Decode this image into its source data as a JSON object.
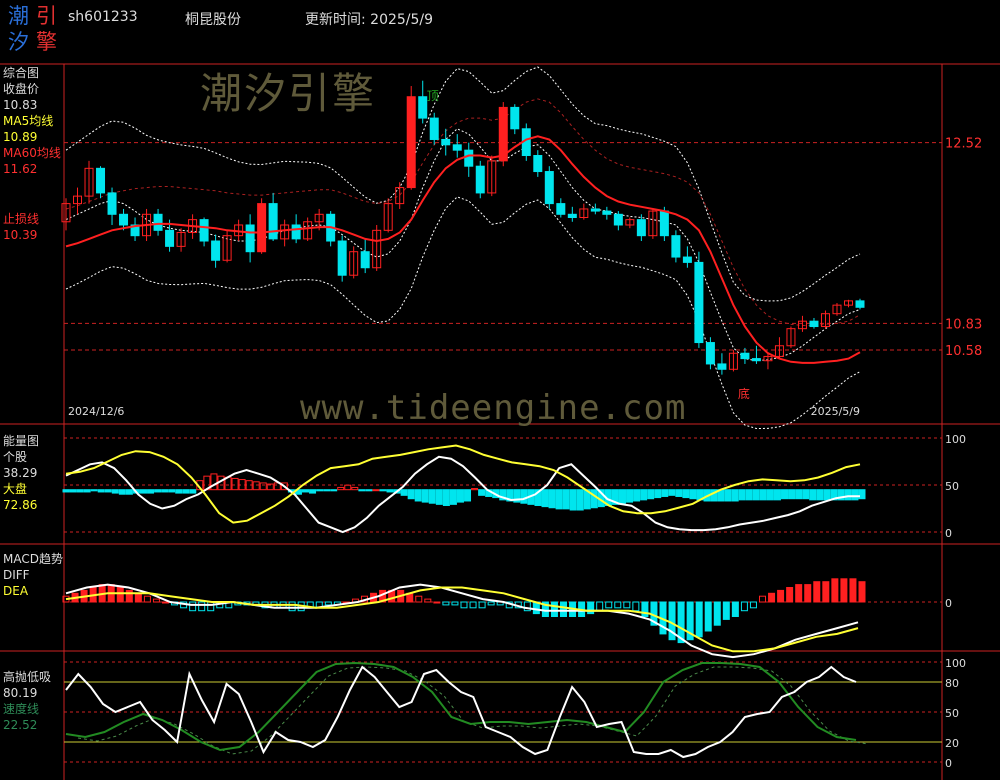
{
  "header": {
    "logo_chars": [
      "潮",
      "引",
      "汐",
      "擎"
    ],
    "code": "sh601233",
    "name": "桐昆股份",
    "update_label": "更新时间: 2025/5/9"
  },
  "watermarks": {
    "cn": "潮汐引擎",
    "url": "www.tideengine.com"
  },
  "colors": {
    "bg": "#000000",
    "frame": "#cc2222",
    "up": "#ff2020",
    "down": "#00e5ee",
    "ma5": "#ffffff",
    "ma60": "#ff2020",
    "band": "#ffffff",
    "energy_stock": "#ffffff",
    "energy_market": "#ffff33",
    "speed": "#228b22",
    "grid": "#cc2222"
  },
  "panels": {
    "main": {
      "title": "综合图",
      "items": [
        {
          "label": "收盘价",
          "value": "10.83",
          "color": "#dddddd"
        },
        {
          "label": "MA5均线",
          "value": "10.89",
          "color": "#ffff33"
        },
        {
          "label": "MA60均线",
          "value": "11.62",
          "color": "#ff3030"
        },
        {
          "label": "止损线",
          "value": "10.39",
          "color": "#ff3030"
        }
      ],
      "axis_labels": [
        "12.52",
        "10.83",
        "10.58"
      ],
      "date_start": "2024/12/6",
      "date_end": "2025/5/9",
      "top_marker": "顶",
      "bottom_marker": "底"
    },
    "energy": {
      "title": "能量图",
      "items": [
        {
          "label": "个股",
          "value": "38.29",
          "color": "#dddddd"
        },
        {
          "label": "大盘",
          "value": "72.86",
          "color": "#ffff33"
        }
      ],
      "axis_labels": [
        "100",
        "50",
        "0"
      ]
    },
    "macd": {
      "title": "MACD趋势",
      "items": [
        {
          "label": "DIFF",
          "value": "",
          "color": "#dddddd"
        },
        {
          "label": "DEA",
          "value": "",
          "color": "#ffff33"
        }
      ],
      "axis_labels": [
        "0"
      ]
    },
    "osc": {
      "title": "高抛低吸",
      "items": [
        {
          "label": "",
          "value": "80.19",
          "color": "#dddddd"
        },
        {
          "label": "速度线",
          "value": "22.52",
          "color": "#2e8b57"
        }
      ],
      "axis_labels": [
        "100",
        "80",
        "50",
        "20",
        "0"
      ]
    }
  },
  "chart_data": [
    {
      "type": "candlestick",
      "title": "综合图",
      "x_range": [
        "2024/12/6",
        "2025/5/9"
      ],
      "ylim": [
        10.15,
        13.2
      ],
      "candles": [
        [
          11.78,
          12.0,
          11.7,
          11.95
        ],
        [
          11.95,
          12.1,
          11.85,
          12.02
        ],
        [
          12.02,
          12.35,
          11.95,
          12.28
        ],
        [
          12.28,
          12.3,
          12.0,
          12.05
        ],
        [
          12.05,
          12.1,
          11.75,
          11.85
        ],
        [
          11.85,
          11.9,
          11.7,
          11.75
        ],
        [
          11.75,
          11.82,
          11.6,
          11.65
        ],
        [
          11.65,
          11.9,
          11.6,
          11.85
        ],
        [
          11.85,
          11.9,
          11.65,
          11.7
        ],
        [
          11.7,
          11.8,
          11.5,
          11.55
        ],
        [
          11.55,
          11.72,
          11.5,
          11.68
        ],
        [
          11.68,
          11.85,
          11.62,
          11.8
        ],
        [
          11.8,
          11.82,
          11.55,
          11.6
        ],
        [
          11.6,
          11.66,
          11.35,
          11.42
        ],
        [
          11.42,
          11.7,
          11.4,
          11.65
        ],
        [
          11.65,
          11.8,
          11.6,
          11.75
        ],
        [
          11.75,
          11.85,
          11.4,
          11.5
        ],
        [
          11.5,
          12.0,
          11.48,
          11.95
        ],
        [
          11.95,
          12.05,
          11.6,
          11.62
        ],
        [
          11.62,
          11.8,
          11.55,
          11.75
        ],
        [
          11.75,
          11.85,
          11.58,
          11.62
        ],
        [
          11.62,
          11.82,
          11.6,
          11.78
        ],
        [
          11.78,
          11.9,
          11.7,
          11.85
        ],
        [
          11.85,
          11.88,
          11.55,
          11.6
        ],
        [
          11.6,
          11.65,
          11.22,
          11.28
        ],
        [
          11.28,
          11.55,
          11.25,
          11.5
        ],
        [
          11.5,
          11.62,
          11.3,
          11.35
        ],
        [
          11.35,
          11.75,
          11.32,
          11.7
        ],
        [
          11.7,
          12.0,
          11.68,
          11.95
        ],
        [
          11.95,
          12.15,
          11.9,
          12.1
        ],
        [
          12.1,
          13.05,
          12.08,
          12.95
        ],
        [
          12.95,
          13.1,
          12.7,
          12.75
        ],
        [
          12.75,
          12.8,
          12.5,
          12.55
        ],
        [
          12.55,
          12.65,
          12.4,
          12.5
        ],
        [
          12.5,
          12.6,
          12.38,
          12.45
        ],
        [
          12.45,
          12.52,
          12.2,
          12.3
        ],
        [
          12.3,
          12.35,
          12.0,
          12.05
        ],
        [
          12.05,
          12.4,
          12.02,
          12.35
        ],
        [
          12.35,
          12.9,
          12.3,
          12.85
        ],
        [
          12.85,
          12.88,
          12.6,
          12.65
        ],
        [
          12.65,
          12.7,
          12.35,
          12.4
        ],
        [
          12.4,
          12.45,
          12.2,
          12.25
        ],
        [
          12.25,
          12.3,
          11.9,
          11.95
        ],
        [
          11.95,
          12.0,
          11.82,
          11.85
        ],
        [
          11.85,
          11.92,
          11.78,
          11.82
        ],
        [
          11.82,
          11.95,
          11.8,
          11.9
        ],
        [
          11.9,
          11.95,
          11.85,
          11.88
        ],
        [
          11.88,
          11.92,
          11.8,
          11.85
        ],
        [
          11.85,
          11.88,
          11.7,
          11.75
        ],
        [
          11.75,
          11.82,
          11.72,
          11.8
        ],
        [
          11.8,
          11.85,
          11.6,
          11.65
        ],
        [
          11.65,
          11.9,
          11.62,
          11.88
        ],
        [
          11.88,
          11.92,
          11.6,
          11.65
        ],
        [
          11.65,
          11.7,
          11.4,
          11.45
        ],
        [
          11.45,
          11.55,
          11.35,
          11.4
        ],
        [
          11.4,
          11.5,
          10.6,
          10.65
        ],
        [
          10.65,
          10.7,
          10.4,
          10.45
        ],
        [
          10.45,
          10.55,
          10.35,
          10.4
        ],
        [
          10.4,
          10.58,
          10.38,
          10.55
        ],
        [
          10.55,
          10.6,
          10.45,
          10.5
        ],
        [
          10.5,
          10.62,
          10.45,
          10.48
        ],
        [
          10.48,
          10.55,
          10.4,
          10.52
        ],
        [
          10.52,
          10.7,
          10.5,
          10.62
        ],
        [
          10.62,
          10.8,
          10.6,
          10.78
        ],
        [
          10.78,
          10.9,
          10.75,
          10.85
        ],
        [
          10.85,
          10.88,
          10.78,
          10.8
        ],
        [
          10.8,
          10.95,
          10.78,
          10.92
        ],
        [
          10.92,
          11.02,
          10.9,
          11.0
        ],
        [
          11.0,
          11.05,
          10.98,
          11.04
        ],
        [
          11.04,
          11.06,
          10.96,
          10.98
        ]
      ],
      "series": [
        {
          "name": "MA5均线",
          "values": [
            11.8,
            11.85,
            11.9,
            11.95,
            11.98,
            11.95,
            11.88,
            11.8,
            11.75,
            11.72,
            11.7,
            11.69,
            11.68,
            11.65,
            11.62,
            11.6,
            11.6,
            11.62,
            11.66,
            11.7,
            11.72,
            11.74,
            11.75,
            11.73,
            11.66,
            11.58,
            11.5,
            11.45,
            11.48,
            11.6,
            11.8,
            12.1,
            12.35,
            12.55,
            12.65,
            12.6,
            12.48,
            12.35,
            12.35,
            12.42,
            12.48,
            12.5,
            12.4,
            12.25,
            12.1,
            11.98,
            11.9,
            11.88,
            11.85,
            11.83,
            11.82,
            11.8,
            11.78,
            11.75,
            11.62,
            11.4,
            11.12,
            10.85,
            10.6,
            10.5,
            10.48,
            10.49,
            10.51,
            10.55,
            10.62,
            10.7,
            10.78,
            10.85,
            10.92,
            10.96
          ]
        },
        {
          "name": "MA60均线",
          "values": [
            11.55,
            11.58,
            11.62,
            11.66,
            11.7,
            11.72,
            11.74,
            11.75,
            11.76,
            11.76,
            11.75,
            11.74,
            11.73,
            11.72,
            11.7,
            11.69,
            11.68,
            11.68,
            11.69,
            11.7,
            11.71,
            11.72,
            11.73,
            11.73,
            11.7,
            11.66,
            11.62,
            11.6,
            11.62,
            11.68,
            11.8,
            11.98,
            12.15,
            12.28,
            12.36,
            12.4,
            12.4,
            12.38,
            12.4,
            12.48,
            12.55,
            12.58,
            12.55,
            12.45,
            12.32,
            12.2,
            12.1,
            12.02,
            11.97,
            11.94,
            11.92,
            11.9,
            11.88,
            11.85,
            11.8,
            11.7,
            11.5,
            11.25,
            11.0,
            10.8,
            10.65,
            10.55,
            10.5,
            10.47,
            10.46,
            10.46,
            10.47,
            10.48,
            10.5,
            10.56
          ]
        }
      ],
      "labeled_levels": [
        12.52,
        10.83,
        10.58
      ]
    },
    {
      "type": "bar",
      "title": "能量图",
      "ylim": [
        0,
        100
      ],
      "baseline": 45,
      "bars": [
        -2,
        -2,
        -2,
        -2,
        -1,
        -2,
        -2,
        -3,
        -4,
        -4,
        -3,
        -3,
        -3,
        -2,
        -2,
        -2,
        -3,
        -3,
        -3,
        8,
        12,
        14,
        12,
        11,
        10,
        9,
        8,
        7,
        6,
        5,
        6,
        6,
        -2,
        -4,
        -2,
        -3,
        -1,
        -1,
        -1,
        2,
        4,
        2,
        -1,
        -1,
        0,
        -1,
        -2,
        -3,
        -5,
        -8,
        -10,
        -11,
        -12,
        -13,
        -14,
        -13,
        -11,
        -10,
        1,
        -5,
        -6,
        -7,
        -9,
        -10,
        -11,
        -12,
        -13,
        -14,
        -15,
        -16,
        -17,
        -17,
        -18,
        -18,
        -17,
        -16,
        -15,
        -14,
        -13,
        -12,
        -11,
        -10,
        -9,
        -8,
        -7,
        -6,
        -5,
        -6,
        -7,
        -8,
        -9,
        -10,
        -10,
        -10,
        -10,
        -10,
        -9,
        -9,
        -9,
        -9,
        -9,
        -9,
        -8,
        -8,
        -8,
        -8,
        -9,
        -9,
        -9,
        -9,
        -9,
        -9,
        -9,
        -8
      ],
      "series": [
        {
          "name": "个股",
          "values": [
            60,
            66,
            72,
            74,
            68,
            55,
            40,
            30,
            25,
            28,
            35,
            40,
            48,
            55,
            62,
            66,
            62,
            58,
            50,
            40,
            25,
            10,
            5,
            0,
            5,
            15,
            28,
            38,
            48,
            62,
            72,
            80,
            78,
            70,
            58,
            45,
            38,
            34,
            35,
            40,
            50,
            68,
            72,
            60,
            48,
            35,
            30,
            28,
            20,
            10,
            5,
            3,
            2,
            2,
            3,
            5,
            8,
            10,
            12,
            15,
            18,
            22,
            28,
            32,
            36,
            38,
            38
          ]
        },
        {
          "name": "大盘",
          "values": [
            62,
            64,
            68,
            75,
            82,
            86,
            85,
            80,
            72,
            58,
            40,
            20,
            10,
            12,
            20,
            28,
            38,
            50,
            60,
            68,
            70,
            72,
            78,
            80,
            82,
            85,
            88,
            90,
            92,
            88,
            82,
            78,
            74,
            72,
            70,
            66,
            58,
            48,
            38,
            28,
            22,
            20,
            20,
            22,
            26,
            30,
            38,
            45,
            50,
            54,
            56,
            55,
            54,
            55,
            58,
            63,
            69,
            72
          ]
        }
      ]
    },
    {
      "type": "bar",
      "title": "MACD趋势",
      "bars": [
        2,
        3,
        4,
        5,
        6,
        6,
        5,
        4,
        3,
        2,
        1,
        0,
        -1,
        -2,
        -3,
        -3,
        -3,
        -2,
        -2,
        -1,
        -1,
        -1,
        -2,
        -2,
        -2,
        -3,
        -3,
        -2,
        -2,
        -1,
        -1,
        0,
        1,
        2,
        3,
        4,
        4,
        4,
        3,
        2,
        1,
        0,
        -1,
        -1,
        -2,
        -2,
        -2,
        -1,
        -1,
        -2,
        -2,
        -3,
        -4,
        -5,
        -5,
        -5,
        -5,
        -5,
        -4,
        -3,
        -2,
        -2,
        -2,
        -3,
        -5,
        -8,
        -11,
        -13,
        -14,
        -13,
        -12,
        -10,
        -8,
        -6,
        -5,
        -3,
        -2,
        2,
        3,
        4,
        5,
        6,
        6,
        7,
        7,
        8,
        8,
        8,
        7
      ],
      "series": [
        {
          "name": "DIFF",
          "values": [
            3,
            5,
            6,
            5,
            3,
            0,
            -1,
            -1,
            0,
            -1,
            -2,
            -2,
            -2,
            -1,
            0,
            2,
            5,
            6,
            5,
            3,
            1,
            0,
            -2,
            -3,
            -3,
            -3,
            -3,
            -4,
            -6,
            -10,
            -15,
            -18,
            -19,
            -18,
            -16,
            -13,
            -11,
            -9,
            -7
          ]
        },
        {
          "name": "DEA",
          "values": [
            1,
            2,
            3,
            3,
            3,
            2,
            1,
            0,
            0,
            -1,
            -1,
            -1,
            -2,
            -2,
            -1,
            0,
            2,
            4,
            5,
            5,
            4,
            3,
            1,
            -1,
            -2,
            -3,
            -3,
            -3,
            -4,
            -7,
            -11,
            -15,
            -17,
            -17,
            -16,
            -14,
            -12,
            -11,
            -9
          ]
        }
      ]
    },
    {
      "type": "line",
      "title": "高抛低吸",
      "ylim": [
        0,
        100
      ],
      "series": [
        {
          "name": "高抛低吸",
          "values": [
            72,
            88,
            75,
            58,
            50,
            55,
            60,
            42,
            32,
            20,
            88,
            62,
            40,
            78,
            68,
            40,
            10,
            30,
            22,
            20,
            15,
            22,
            45,
            72,
            95,
            85,
            70,
            55,
            60,
            88,
            92,
            80,
            70,
            65,
            35,
            30,
            25,
            15,
            8,
            12,
            45,
            75,
            60,
            35,
            38,
            40,
            10,
            8,
            8,
            12,
            5,
            8,
            15,
            20,
            30,
            45,
            48,
            50,
            65,
            70,
            80,
            85,
            95,
            85,
            80
          ]
        },
        {
          "name": "速度线",
          "values": [
            28,
            25,
            30,
            40,
            48,
            42,
            32,
            20,
            12,
            15,
            30,
            50,
            70,
            90,
            98,
            99,
            98,
            95,
            85,
            70,
            45,
            38,
            40,
            40,
            38,
            40,
            42,
            40,
            35,
            30,
            50,
            80,
            92,
            99,
            99,
            98,
            95,
            80,
            55,
            35,
            25,
            22
          ]
        }
      ]
    }
  ]
}
